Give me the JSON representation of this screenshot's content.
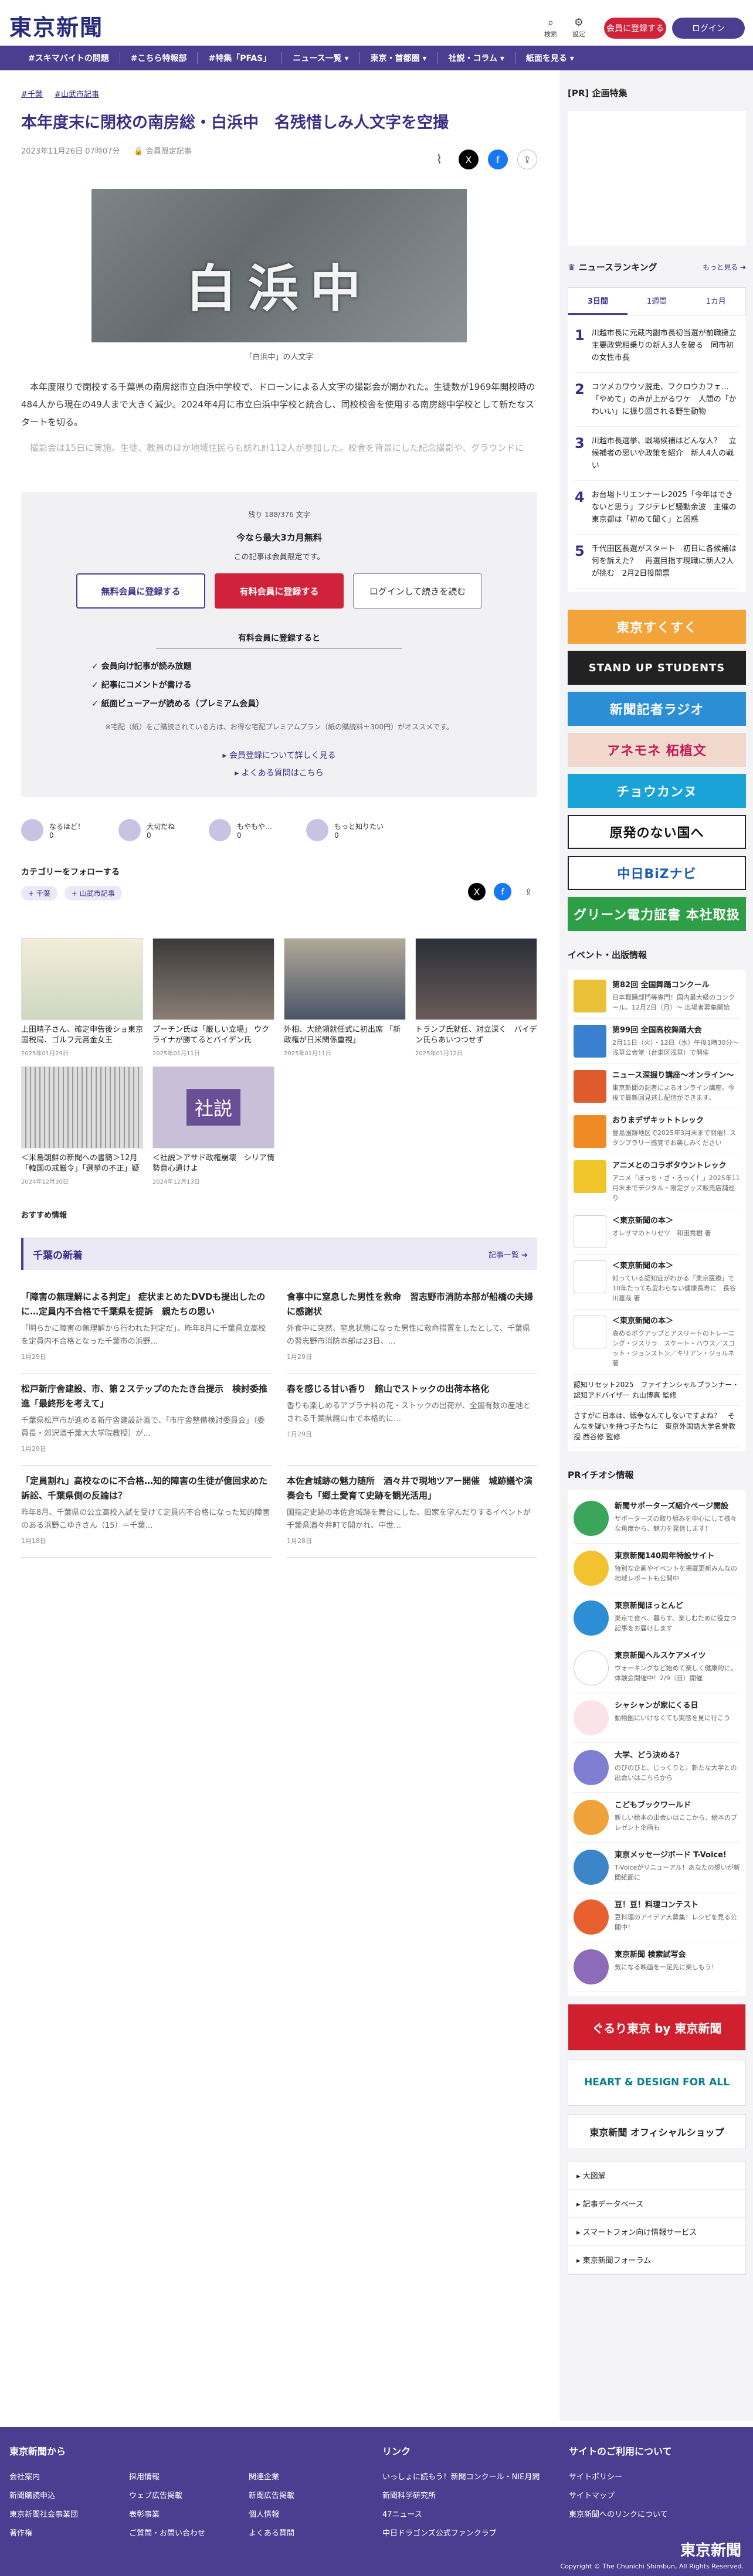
{
  "header": {
    "logo": "東京新聞",
    "search_label": "検索",
    "settings_label": "設定",
    "register_label": "会員に登録する",
    "login_label": "ログイン"
  },
  "nav": [
    "#スキマバイトの問題",
    "#こちら特報部",
    "#特集「PFAS」",
    "ニュース一覧 ▾",
    "東京・首都圏 ▾",
    "社説・コラム ▾",
    "紙面を見る ▾"
  ],
  "article": {
    "tags": [
      "#千葉",
      "#山武市記事"
    ],
    "headline": "本年度末に閉校の南房総・白浜中　名残惜しみ人文字を空撮",
    "date": "2023年11月26日 07時07分",
    "member_note": "会員限定記事",
    "photo_text": "白浜中",
    "photo_caption": "「白浜中」の人文字",
    "para1": "本年度限りで閉校する千葉県の南房総市立白浜中学校で、ドローンによる人文字の撮影会が開かれた。生徒数が1969年開校時の484人から現在の49人まで大きく減少。2024年4月に市立白浜中学校と統合し、同校校舎を使用する南房総中学校として新たなスタートを切る。",
    "para2": "撮影会は15日に実施。生徒、教員のほか地域住民らも訪れ計112人が参加した。校舎を背景にした記念撮影や、グラウンドに"
  },
  "paywall": {
    "remaining": "残り 188/376 文字",
    "offer": "今なら最大3カ月無料",
    "limited": "この記事は会員限定です。",
    "btn_free": "無料会員に登録する",
    "btn_paid": "有料会員に登録する",
    "btn_login": "ログインして続きを読む",
    "benefit_heading": "有料会員に登録すると",
    "benefits": [
      "✓ 会員向け記事が読み放題",
      "✓ 記事にコメントが書ける",
      "✓ 紙面ビューアーが読める（プレミアム会員）"
    ],
    "note": "※宅配（紙）をご購読されている方は、お得な宅配プレミアムプラン（紙の購読料＋300円）がオススメです。",
    "link1": "▸ 会員登録について詳しく見る",
    "link2": "▸ よくある質問はこちら"
  },
  "reactions": [
    "なるほど！",
    "大切だね",
    "もやもや…",
    "もっと知りたい"
  ],
  "reaction_counts": [
    "0",
    "0",
    "0",
    "0"
  ],
  "category": {
    "heading": "カテゴリーをフォローする",
    "tags": [
      "+ 千葉",
      "+ 山武市記事"
    ]
  },
  "thumbs": [
    {
      "title": "上田晴子さん、確定申告後ショ東京国税局、ゴルフ元賞金女王",
      "date": "2025年01月29日"
    },
    {
      "title": "プーチン氏は「厳しい立場」 ウクライナが勝てるとバイデン氏",
      "date": "2025年01月11日"
    },
    {
      "title": "外相、大統領就任式に初出席 「新政権が日米関係重視」",
      "date": "2025年01月11日"
    },
    {
      "title": "トランプ氏就任、対立深く　バイデン氏らあいつつせず",
      "date": "2025年01月12日"
    },
    {
      "title": "＜米島朝鮮の新聞への書簡＞12月「韓国の戒厳令」「選挙の不正」疑らて世界",
      "date": "2024年12月30日"
    },
    {
      "title": "＜社説＞アサド政権崩壊　シリア情勢意心遣けよ",
      "date": "2024年12月13日"
    }
  ],
  "thumb_badge": "社説",
  "recommend_heading": "おすすめ情報",
  "chiba_news": {
    "title": "千葉の新着",
    "more": "記事一覧 ➔",
    "items": [
      {
        "headline": "「障害の無理解による判定」 症状まとめたDVDも提出したのに…定員内不合格で千葉県を提訴　親たちの思い",
        "text": "「明らかに障害の無理解から行われた判定だ」。昨年8月に千葉県立高校を定員内不合格となった千葉市の浜野…",
        "date": "1月29日"
      },
      {
        "headline": "食事中に窒息した男性を救命　習志野市消防本部が船橋の夫婦に感謝状",
        "text": "外食中に突然、窒息状態になった男性に救命措置をしたとして、千葉県の習志野市消防本部は23日、…",
        "date": "1月29日"
      },
      {
        "headline": "松戸新庁舎建設、市、第２ステップのたたき台提示　検討委推進「最終形を考えて」",
        "text": "千葉県松戸市が進める新庁舎建設計画で、「市庁舎整備検討委員会」（委員長・郊沢酒千葉大大学院教授）が…",
        "date": "1月29日"
      },
      {
        "headline": "春を感じる甘い香り　館山でストックの出荷本格化",
        "text": "香りも楽しめるアブラナ科の花・ストックの出荷が、全国有数の産地とされる千葉県館山市で本格的に…",
        "date": "1月29日"
      },
      {
        "headline": "「定員割れ」高校なのに不合格…知的障害の生徒が億回求めた訴訟、千葉県側の反論は？",
        "text": "昨年8月、千葉県の公立高校入試を受けて定員内不合格になった知的障害のある浜野こゆきさん（15）＝千葉…",
        "date": "1月18日"
      },
      {
        "headline": "本佐倉城跡の魅力随所　酒々井で現地ツアー開催　城跡議や演奏会も「郷土愛育て史跡を観光活用」",
        "text": "国指定史跡の本佐倉城跡を舞台にした、旧家を学んだりするイベントが千葉県酒々井町で開かれ、中世…",
        "date": "1月28日"
      }
    ]
  },
  "sidebar": {
    "pr_title": "[PR] 企画特集",
    "ranking_title": "ニュースランキング",
    "ranking_more": "もっと見る ➔",
    "tabs": [
      "3日間",
      "1週間",
      "1カ月"
    ],
    "ranking": [
      "川越市長に元蔵内副市長初当選が前職擁立主要政党相乗りの新人3人を破る　同市初の女性市長",
      "コツメカワウソ脱走、フクロウカフェ…「やめて」の声が上がるワケ　人間の「かわいい」に振り回される野生動物",
      "川越市長選挙、戦場候補はどんな人？　立候補者の思いや政策を紹介　新人4人の戦い",
      "お台場トリエンナーレ2025「今年はできないと思う」フジテレビ騒動余波　主催の東京都は「初めて聞く」と困惑",
      "千代田区長選がスタート　初日に各候補は何を訴えた？　再選目指す現職に新人2人が挑む　2月2日投開票"
    ],
    "banners": [
      "東京すくすく",
      "STAND UP STUDENTS",
      "新聞記者ラジオ",
      "アネモネ 柘植文",
      "チョウカンヌ",
      "原発のない国へ",
      "中日BiZナビ",
      "グリーン電力証書 本社取扱"
    ],
    "event_title": "イベント・出版情報",
    "events": [
      {
        "title": "第82回 全国舞踊コンクール",
        "desc": "日本舞踊部門等専門！国内最大級のコンクール。12月2日（月）～ 出場者募集開始"
      },
      {
        "title": "第99回 全国高校舞踊大会",
        "desc": "2月11日（火）・12日（水）午後1時30分～　浅草公会堂（台東区浅草）で開催"
      },
      {
        "title": "ニュース深掘り講座〜オンライン〜",
        "desc": "東京新聞の記者によるオンライン講座。今後で最新回見逃し配信ができます。"
      },
      {
        "title": "おりまデザキットトレック",
        "desc": "豊島園跡地区で2025年3月末まで開催！スタンプラリー感覚でお楽しみください"
      },
      {
        "title": "アニメとのコラボタウントレック",
        "desc": "アニメ「ぼっち・ざ・ろっく！」2025年11月末までデジタル・限定グッズ販売店舗巡り"
      },
      {
        "title": "＜東京新聞の本＞",
        "desc": "オレザマのトリセツ　和田秀樹 著"
      },
      {
        "title": "＜東京新聞の本＞",
        "desc": "知っている認知症がわかる「東京医療」で10年たっても変わらない健康長寿に　長谷川嘉哉 著"
      },
      {
        "title": "＜東京新聞の本＞",
        "desc": "高めるボクアップとアスリートのトレーニング・ジスリラ　スケート・ハウス／スコット・ジョンストン／キリアン・ジョルネ 著"
      }
    ],
    "event_plain": [
      "認知リセット2025　ファイナンシャルプランナー・認知アドバイザー 丸山博真 監修",
      "さすがに日本は、戦争なんてしないですよね？　そんなを疑いを持つ子たちに　東京外国語大学名誉教授 西谷修 監修"
    ],
    "pr2_title": "PRイチオシ情報",
    "pr2": [
      {
        "title": "新聞サポーターズ紹介ページ開設",
        "desc": "サポーターズの取り組みを中心にして様々な角度から、魅力を発信します！"
      },
      {
        "title": "東京新聞140周年特設サイト",
        "desc": "特別な企画やイベントを掲載更新みんなの地域レポートも公開中"
      },
      {
        "title": "東京新聞ほっとんど",
        "desc": "東京で食べ、暮らす、楽しむために役立つ記事をお届けします"
      },
      {
        "title": "東京新聞ヘルスケアメイツ",
        "desc": "ウォーキングなど始めて楽しく健康的に。体験会開催中！2/9（日）開催"
      },
      {
        "title": "シャシャンが家にくる日",
        "desc": "動物園にいけなくても実感を見に行こう"
      },
      {
        "title": "大学、どう決める？",
        "desc": "のびのびと、じっくりと。新たな大学との出会いはこちらから"
      },
      {
        "title": "こどもブックワールド",
        "desc": "新しい絵本の出会いはここから、絵本のプレゼント企画も"
      },
      {
        "title": "東京メッセージボード T-Voice!",
        "desc": "T-Voiceがリニューアル！あなたの想いが新聞紙面に"
      },
      {
        "title": "豆！豆！料理コンテスト",
        "desc": "豆料理のアイデア大募集！レシピを見る公開中！"
      },
      {
        "title": "東京新聞 検索試写会",
        "desc": "気になる映画を一足先に楽しもう！"
      }
    ],
    "bottom_banners": [
      "ぐるり東京 by 東京新聞",
      "HEART & DESIGN FOR ALL",
      "東京新聞 オフィシャルショップ"
    ],
    "links": [
      "▸ 大図解",
      "▸ 記事データベース",
      "▸ スマートフォン向け情報サービス",
      "▸ 東京新聞フォーラム"
    ]
  },
  "footer": {
    "col1_title": "東京新聞から",
    "col1": [
      "会社案内",
      "新聞購読申込",
      "東京新聞社会事業団",
      "著作権"
    ],
    "col1b": [
      "採用情報",
      "ウェブ広告掲載",
      "表彰事業",
      "ご質問・お問い合わせ"
    ],
    "col1c": [
      "関連企業",
      "新聞広告掲載",
      "個人情報",
      "よくある質問"
    ],
    "col2_title": "リンク",
    "col2": [
      "いっしょに読もう！新聞コンクール・NIE月間",
      "新聞科学研究所",
      "47ニュース",
      "中日ドラゴンズ公式ファンクラブ"
    ],
    "col3_title": "サイトのご利用について",
    "col3": [
      "サイトポリシー",
      "サイトマップ",
      "東京新聞へのリンクについて"
    ],
    "logo": "東京新聞",
    "copyright": "Copyright © The Chunichi Shimbun, All Rights Reserved."
  },
  "colors": {
    "brand": "#4b3d8f",
    "accent_red": "#d0233b"
  }
}
